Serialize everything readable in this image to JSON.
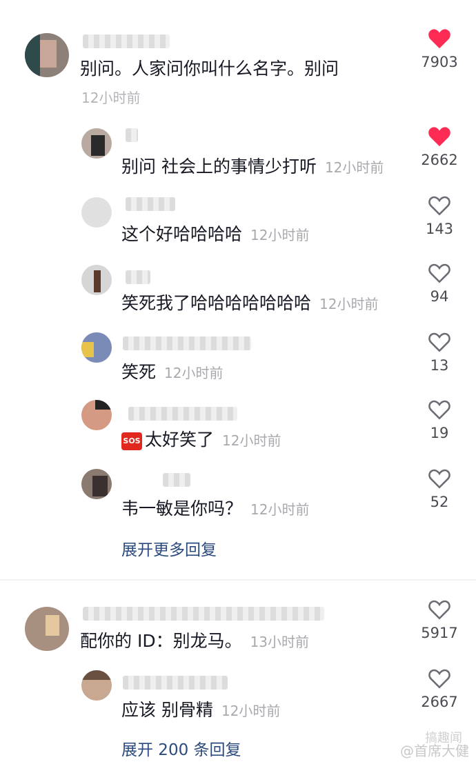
{
  "comments": [
    {
      "text": "别问。人家问你叫什么名字。别问",
      "time": "12小时前",
      "likes": "7903",
      "liked": true
    },
    {
      "text": "别问 社会上的事情少打听",
      "time": "12小时前",
      "likes": "2662",
      "liked": true
    },
    {
      "text": "这个好哈哈哈哈",
      "time": "12小时前",
      "likes": "143",
      "liked": false
    },
    {
      "text": "笑死我了哈哈哈哈哈哈哈",
      "time": "12小时前",
      "likes": "94",
      "liked": false
    },
    {
      "text": "笑死",
      "time": "12小时前",
      "likes": "13",
      "liked": false
    },
    {
      "text": "太好笑了",
      "time": "12小时前",
      "likes": "19",
      "liked": false,
      "emoji": "SOS"
    },
    {
      "text": "韦一敏是你吗？",
      "time": "12小时前",
      "likes": "52",
      "liked": false
    },
    {
      "text": "配你的 ID：别龙马。",
      "time": "13小时前",
      "likes": "5917",
      "liked": false
    },
    {
      "text": "应该 别骨精",
      "time": "12小时前",
      "likes": "2667",
      "liked": false
    }
  ],
  "expand_more": "展开更多回复",
  "expand_200": "展开 200 条回复",
  "watermark": "搞趣闻",
  "watermark2": "@首席大健",
  "colors": {
    "liked": "#fe2c55",
    "outline": "#6b6b73",
    "link": "#2b4a7d"
  }
}
